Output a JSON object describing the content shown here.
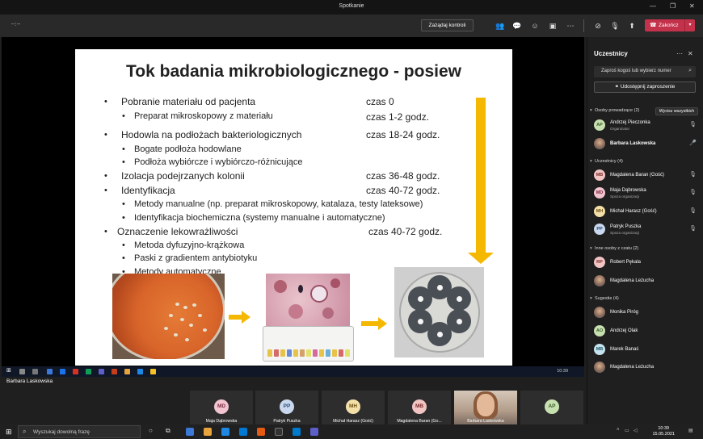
{
  "window": {
    "title": "Spotkanie"
  },
  "toolbar": {
    "timer": "--:--",
    "take_control": "Zażądaj kontroli",
    "leave": "Zakończ"
  },
  "slide": {
    "title": "Tok badania mikrobiologicznego - posiew",
    "items": [
      {
        "text": "Pobranie materiału od pacjenta",
        "time": "czas 0"
      },
      {
        "text": "Preparat mikroskopowy z materiału",
        "time": "czas 1-2 godz."
      },
      {
        "text": "Hodowla na podłożach bakteriologicznych",
        "time": "czas 18-24 godz."
      },
      {
        "text": "Bogate podłoża hodowlane"
      },
      {
        "text": "Podłoża wybiórcze i wybiórczo-różnicujące"
      },
      {
        "text": "Izolacja podejrzanych kolonii",
        "time": "czas 36-48 godz."
      },
      {
        "text": "Identyfikacja",
        "time": "czas 40-72 godz."
      },
      {
        "text": "Metody manualne (np. preparat mikroskopowy, katalaza, testy lateksowe)"
      },
      {
        "text": "Identyfikacja biochemiczna (systemy manualne i automatyczne)"
      },
      {
        "text": "Oznaczenie lekowrażliwości",
        "time": "czas 40-72 godz."
      },
      {
        "text": "Metoda dyfuzyjno-krążkowa"
      },
      {
        "text": "Paski z gradientem antybiotyku"
      },
      {
        "text": "Metody automatyczne"
      }
    ]
  },
  "presenter_label": "Barbara Laskowska",
  "inner_taskbar_time": "10:39",
  "panel": {
    "title": "Uczestnicy",
    "search_placeholder": "Zaproś kogoś lub wybierz numer",
    "share_invite": "Udostępnij zaproszenie",
    "presenters_header": "Osoby prowadzące (2)",
    "mute_all": "Wycisz wszystkich",
    "presenters": [
      {
        "initials": "AP",
        "name": "Andrzej Pieczonka",
        "role": "Organizator",
        "color": "#c7e0b0",
        "fg": "#3b5a27"
      },
      {
        "initials": "",
        "name": "Barbara Laskowska",
        "role": "",
        "color": "",
        "fg": ""
      }
    ],
    "attendees_header": "Uczestnicy (4)",
    "attendees": [
      {
        "initials": "MB",
        "name": "Magdalena Baran (Gość)",
        "role": "",
        "color": "#f2c4c4",
        "fg": "#7a2b2b"
      },
      {
        "initials": "MD",
        "name": "Maja Dąbrowska",
        "role": "Spoza organizacji",
        "color": "#f2c4d0",
        "fg": "#7a2b40"
      },
      {
        "initials": "MH",
        "name": "Michał Harasz (Gość)",
        "role": "",
        "color": "#f3dfa8",
        "fg": "#6b5113"
      },
      {
        "initials": "PP",
        "name": "Patryk Puszka",
        "role": "Spoza organizacji",
        "color": "#c9d8ee",
        "fg": "#2c4a75"
      }
    ],
    "others_header": "Inne osoby z czatu (2)",
    "others": [
      {
        "initials": "RP",
        "name": "Robert Pękala",
        "color": "#f2c4c4",
        "fg": "#7a2b2b"
      },
      {
        "initials": "",
        "name": "Magdalena Leżucha",
        "color": "",
        "fg": ""
      }
    ],
    "suggestions_header": "Sugestie (4)",
    "suggestions": [
      {
        "initials": "",
        "name": "Monika Piróg",
        "color": "",
        "fg": ""
      },
      {
        "initials": "AO",
        "name": "Andrzej Olak",
        "color": "#c7e0b0",
        "fg": "#3b5a27"
      },
      {
        "initials": "MB",
        "name": "Marek Banaś",
        "color": "#c4e3ee",
        "fg": "#24586b"
      },
      {
        "initials": "",
        "name": "Magdalena Leżucha",
        "color": "",
        "fg": ""
      }
    ]
  },
  "gallery": [
    {
      "initials": "MD",
      "name": "Maja Dąbrowska",
      "color": "#f2c4d0",
      "fg": "#7a2b40",
      "video": false
    },
    {
      "initials": "PP",
      "name": "Patryk Puszka",
      "color": "#c9d8ee",
      "fg": "#2c4a75",
      "video": false
    },
    {
      "initials": "MH",
      "name": "Michał Harasz (Gość)",
      "color": "#f3dfa8",
      "fg": "#6b5113",
      "video": false
    },
    {
      "initials": "MB",
      "name": "Magdalena Baran (Go...",
      "color": "#f2c4c4",
      "fg": "#7a2b2b",
      "video": false
    },
    {
      "initials": "",
      "name": "Barbara Laskowska",
      "color": "",
      "fg": "",
      "video": true
    },
    {
      "initials": "AP",
      "name": "",
      "color": "#c7e0b0",
      "fg": "#3b5a27",
      "video": false
    }
  ],
  "taskbar": {
    "search_placeholder": "Wyszukaj dowolną frazę",
    "time": "10:39",
    "date": "15.05.2021"
  },
  "colors": {
    "accent_red": "#c4314b",
    "arrow": "#f5b800"
  }
}
